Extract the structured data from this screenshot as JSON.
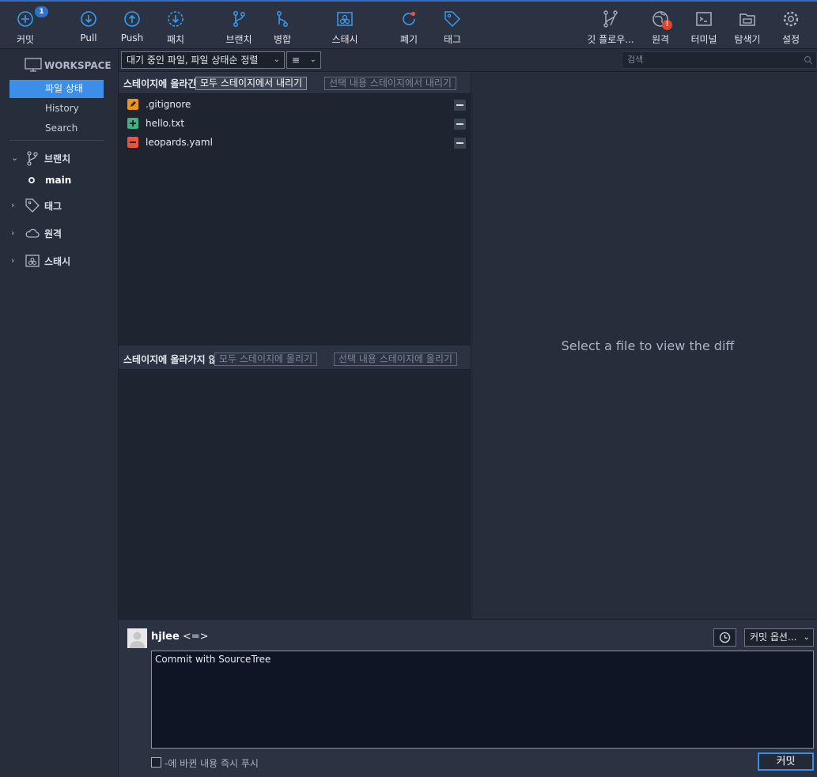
{
  "toolbar": {
    "commit": {
      "label": "커밋",
      "badge": "1",
      "icon": "plus-circle-icon"
    },
    "pull": {
      "label": "Pull",
      "icon": "arrow-down-circle-icon"
    },
    "push": {
      "label": "Push",
      "icon": "arrow-up-circle-icon"
    },
    "fetch": {
      "label": "패치",
      "icon": "fetch-circle-icon"
    },
    "branch": {
      "label": "브랜치",
      "icon": "branch-icon"
    },
    "merge": {
      "label": "병합",
      "icon": "merge-icon"
    },
    "stash": {
      "label": "스태시",
      "icon": "stash-icon"
    },
    "discard": {
      "label": "폐기",
      "icon": "discard-icon"
    },
    "tag": {
      "label": "태그",
      "icon": "tag-icon"
    },
    "gitflow": {
      "label": "깃 플로우...",
      "icon": "gitflow-icon"
    },
    "remote": {
      "label": "원격",
      "icon": "globe-icon",
      "alert": "!"
    },
    "terminal": {
      "label": "터미널",
      "icon": "terminal-icon"
    },
    "explorer": {
      "label": "탐색기",
      "icon": "folder-icon"
    },
    "settings": {
      "label": "설정",
      "icon": "gear-icon"
    }
  },
  "sidebar": {
    "workspace": "WORKSPACE",
    "items": [
      {
        "label": "파일 상태",
        "active": true
      },
      {
        "label": "History",
        "active": false
      },
      {
        "label": "Search",
        "active": false
      }
    ],
    "sections": {
      "branches": "브랜치",
      "tags": "태그",
      "remotes": "원격",
      "stashes": "스태시"
    },
    "current_branch": "main"
  },
  "filter": {
    "sort_select": "대기 중인 파일, 파일 상태순 정렬",
    "view_icon": "≡",
    "search_placeholder": "검색"
  },
  "staged": {
    "title": "스테이지에 올라간 파일",
    "unstage_all": "모두 스테이지에서 내리기",
    "unstage_selected": "선택 내용 스테이지에서 내리기",
    "files": [
      {
        "name": ".gitignore",
        "status": "modified"
      },
      {
        "name": "hello.txt",
        "status": "added"
      },
      {
        "name": "leopards.yaml",
        "status": "deleted"
      }
    ]
  },
  "unstaged": {
    "title": "스테이지에 올라가지 않은 파일",
    "stage_all": "모두 스테이지에 올리기",
    "stage_selected": "선택 내용 스테이지에 올리기"
  },
  "diff": {
    "message": "Select a file to view the diff"
  },
  "commit": {
    "author": "hjlee",
    "email": "<=>",
    "options": "커밋 옵션...",
    "message": "Commit with SourceTree",
    "push_label": "-에 바뀐 내용 즉시 푸시",
    "button": "커밋"
  },
  "colors": {
    "accent": "#3d8ee6",
    "modified": "#f0960e",
    "added": "#3fb27f",
    "deleted": "#e9553a",
    "toolbar_icon": "#3b9af0"
  }
}
